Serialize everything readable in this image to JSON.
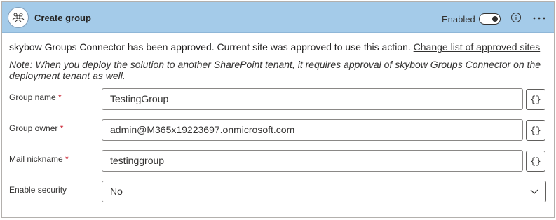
{
  "header": {
    "title": "Create group",
    "enabled_label": "Enabled",
    "toggle_on": true,
    "icons": {
      "action": "people-group-icon",
      "info": "info-icon",
      "more": "more-icon"
    }
  },
  "approval": {
    "text": "skybow Groups Connector has been approved. Current site was approved to use this action.",
    "link": "Change list of approved sites"
  },
  "note": {
    "prefix": "Note: When you deploy the solution to another SharePoint tenant, it requires",
    "link": "approval of skybow Groups Connector",
    "suffix": "on the deployment tenant as well."
  },
  "fields": [
    {
      "label": "Group name",
      "required": "*",
      "value": "TestingGroup",
      "expr": "{}"
    },
    {
      "label": "Group owner",
      "required": "*",
      "value": "admin@M365x19223697.onmicrosoft.com",
      "expr": "{}"
    },
    {
      "label": "Mail nickname",
      "required": "*",
      "value": "testinggroup",
      "expr": "{}"
    }
  ],
  "security": {
    "label": "Enable security",
    "value": "No"
  },
  "colors": {
    "header_bg": "#a4cbe9",
    "required": "#c50f1f"
  }
}
